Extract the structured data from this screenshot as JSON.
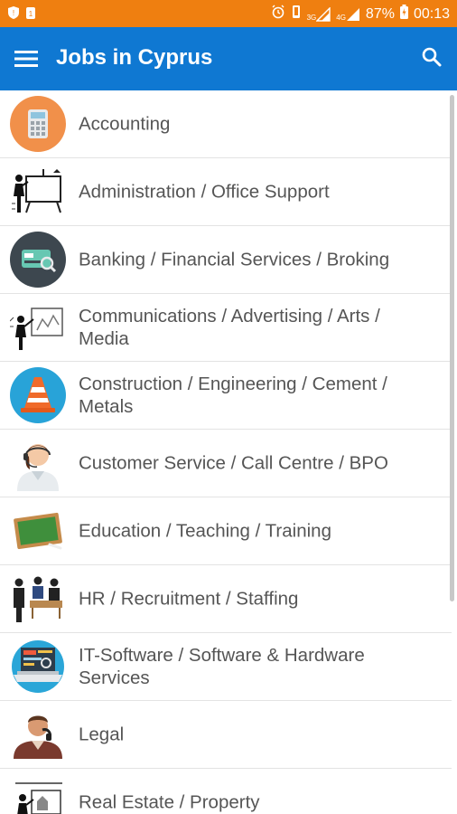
{
  "status": {
    "battery": "87%",
    "time": "00:13",
    "net1": "3G",
    "net2": "4G"
  },
  "appbar": {
    "title": "Jobs in Cyprus"
  },
  "categories": [
    {
      "label": "Accounting",
      "icon": "calculator-icon"
    },
    {
      "label": "Administration / Office Support",
      "icon": "presentation-board-icon"
    },
    {
      "label": "Banking / Financial Services / Broking",
      "icon": "bank-card-icon"
    },
    {
      "label": "Communications / Advertising / Arts / Media",
      "icon": "media-presentation-icon"
    },
    {
      "label": "Construction / Engineering / Cement / Metals",
      "icon": "traffic-cone-icon"
    },
    {
      "label": "Customer Service / Call Centre / BPO",
      "icon": "call-centre-agent-icon"
    },
    {
      "label": "Education / Teaching / Training",
      "icon": "chalkboard-icon"
    },
    {
      "label": "HR / Recruitment / Staffing",
      "icon": "team-meeting-icon"
    },
    {
      "label": "IT-Software / Software & Hardware Services",
      "icon": "laptop-code-icon"
    },
    {
      "label": "Legal",
      "icon": "lawyer-icon"
    },
    {
      "label": "Real Estate / Property",
      "icon": "property-presentation-icon"
    }
  ],
  "colors": {
    "status_bar": "#ef7f10",
    "app_bar": "#0f78d2",
    "text": "#555555"
  }
}
